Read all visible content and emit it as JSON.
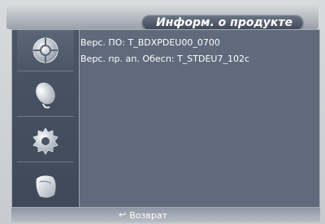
{
  "header": {
    "title": "Информ. о продукте"
  },
  "sidebar": {
    "items": [
      {
        "icon": "picture-icon",
        "active": true
      },
      {
        "icon": "satellite-dish-icon",
        "active": false
      },
      {
        "icon": "settings-gear-icon",
        "active": false
      },
      {
        "icon": "input-plug-icon",
        "active": false
      }
    ]
  },
  "info": {
    "software_version": "Верс. ПО: T_BDXPDEU00_0700",
    "support_version": "Верс. пр. ап. Обесп: T_STDEU7_102c"
  },
  "footer": {
    "return_label": "Возврат",
    "return_icon": "↩"
  },
  "colors": {
    "panel": "#5f6a7c",
    "sidebar": "#4a5566",
    "text": "#ffffff"
  }
}
